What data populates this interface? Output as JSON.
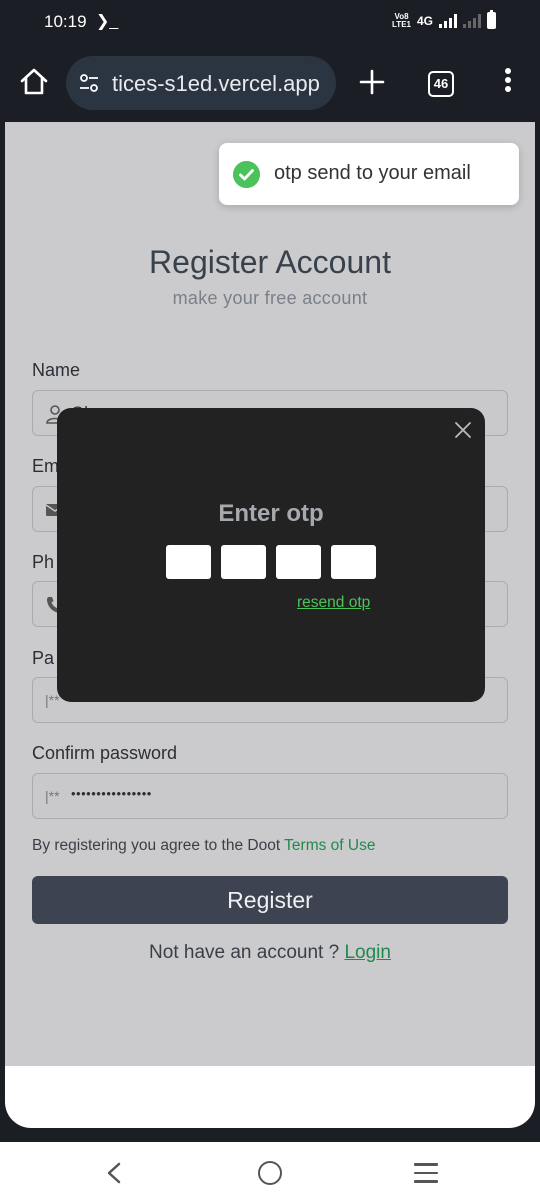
{
  "status_bar": {
    "time": "10:19",
    "terminal_glyph": "❯_",
    "volte_top": "Vo8",
    "volte_bottom": "LTE1",
    "network": "4G"
  },
  "browser": {
    "url": "tices-s1ed.vercel.app",
    "tab_count": "46"
  },
  "toast": {
    "message": "otp send to your email",
    "accent": "#4bc35a"
  },
  "page": {
    "title": "Register Account",
    "subtitle": "make your free account",
    "fields": {
      "name_label": "Name",
      "name_value": "Ob",
      "email_label": "Em",
      "phone_label": "Ph",
      "password_label": "Pa",
      "password_placeholder": "|**",
      "confirm_label": "Confirm password",
      "confirm_placeholder": "|**",
      "confirm_value": "••••••••••••••••"
    },
    "agree_text": "By registering you agree to the Doot ",
    "terms_link": "Terms of Use",
    "register_label": "Register",
    "login_prompt": "Not have an account ? ",
    "login_link": "Login"
  },
  "otp_modal": {
    "title": "Enter otp",
    "digits": [
      "",
      "",
      "",
      ""
    ],
    "resend_label": "resend otp"
  },
  "colors": {
    "link_green": "#1f8a4c",
    "button_dark": "#3d4350",
    "overlay_gray": "#cbcbcd"
  }
}
